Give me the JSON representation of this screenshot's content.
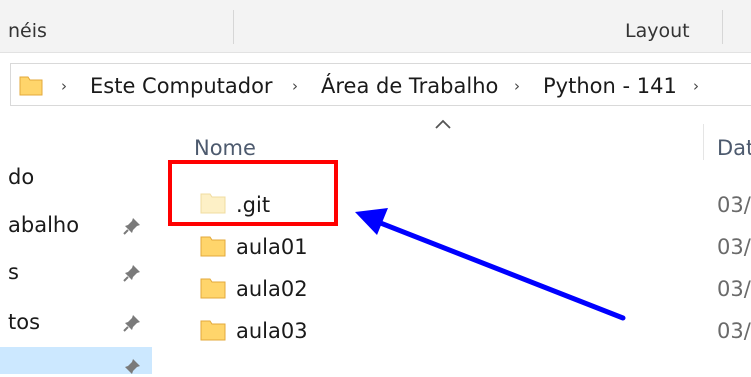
{
  "ribbon": {
    "panes_label": "néis",
    "layout_label": "Layout"
  },
  "address_bar": {
    "crumbs": [
      "Este Computador",
      "Área de Trabalho",
      "Python - 141"
    ]
  },
  "sidebar": {
    "items": [
      {
        "label": "do",
        "pinned": false
      },
      {
        "label": "abalho",
        "pinned": true
      },
      {
        "label": "s",
        "pinned": true
      },
      {
        "label": "tos",
        "pinned": true
      }
    ]
  },
  "file_list": {
    "columns": {
      "name": "Nome",
      "date": "Dat"
    },
    "rows": [
      {
        "name": ".git",
        "date": "03/",
        "hidden": true
      },
      {
        "name": "aula01",
        "date": "03/",
        "hidden": false
      },
      {
        "name": "aula02",
        "date": "03/",
        "hidden": false
      },
      {
        "name": "aula03",
        "date": "03/",
        "hidden": false
      }
    ]
  },
  "annotation": {
    "highlight_color": "#ff0000",
    "arrow_color": "#0000ff"
  }
}
